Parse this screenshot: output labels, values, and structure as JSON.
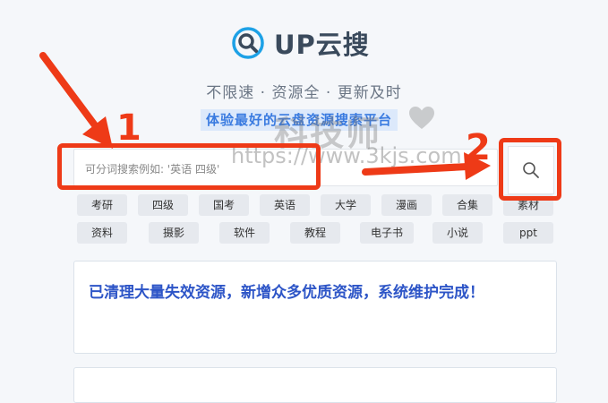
{
  "brand": {
    "name": "UP云搜"
  },
  "slogan": "不限速 · 资源全 · 更新及时",
  "subtitle": "体验最好的云盘资源搜索平台",
  "search": {
    "placeholder": "可分词搜索例如: '英语 四级'"
  },
  "tags_row1": [
    "考研",
    "四级",
    "国考",
    "英语",
    "大学",
    "漫画",
    "合集",
    "素材"
  ],
  "tags_row2": [
    "资料",
    "摄影",
    "软件",
    "教程",
    "电子书",
    "小说",
    "ppt"
  ],
  "notice": {
    "text": "已清理大量失效资源，新增众多优质资源，系统维护完成！"
  },
  "watermark": {
    "text_cn": "科技师",
    "url": "https://www.3kjs.com"
  },
  "annotations": {
    "label1": "1",
    "label2": "2",
    "color": "#ee3a17"
  },
  "colors": {
    "accent": "#2d55c7",
    "subtitle_bg": "#dce9fb",
    "tag_bg": "#e6e9ee"
  }
}
